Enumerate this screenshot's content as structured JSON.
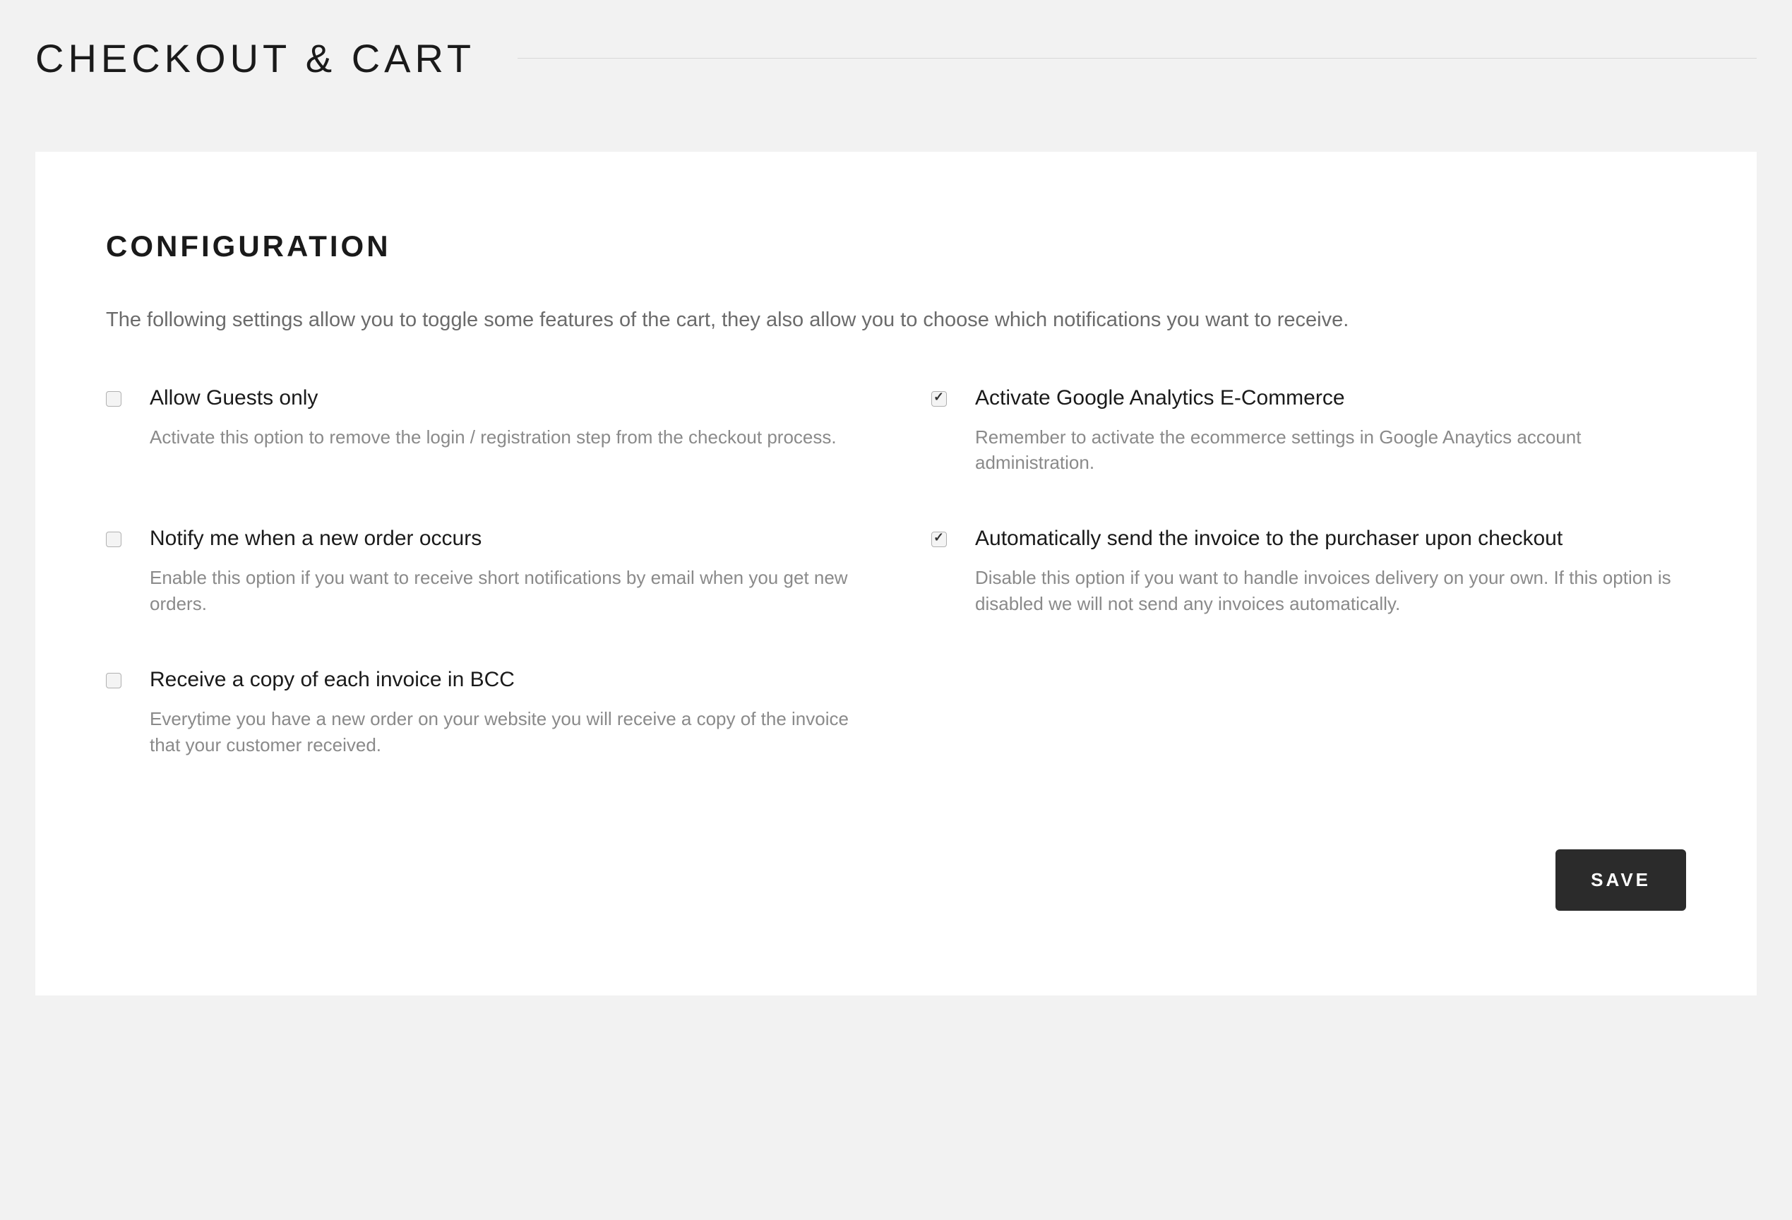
{
  "page": {
    "title": "CHECKOUT & CART"
  },
  "section": {
    "title": "CONFIGURATION",
    "description": "The following settings allow you to toggle some features of the cart, they also allow you to choose which notifications you want to receive."
  },
  "settings": {
    "allow_guests": {
      "label": "Allow Guests only",
      "help": "Activate this option to remove the login / registration step from the checkout process.",
      "checked": false
    },
    "google_analytics": {
      "label": "Activate Google Analytics E-Commerce",
      "help": "Remember to activate the ecommerce settings in Google Anaytics account administration.",
      "checked": true
    },
    "notify_new_order": {
      "label": "Notify me when a new order occurs",
      "help": "Enable this option if you want to receive short notifications by email when you get new orders.",
      "checked": false
    },
    "auto_invoice": {
      "label": "Automatically send the invoice to the purchaser upon checkout",
      "help": "Disable this option if you want to handle invoices delivery on your own. If this option is disabled we will not send any invoices automatically.",
      "checked": true
    },
    "bcc_invoice": {
      "label": "Receive a copy of each invoice in BCC",
      "help": "Everytime you have a new order on your website you will receive a copy of the invoice that your customer received.",
      "checked": false
    }
  },
  "actions": {
    "save": "SAVE"
  }
}
